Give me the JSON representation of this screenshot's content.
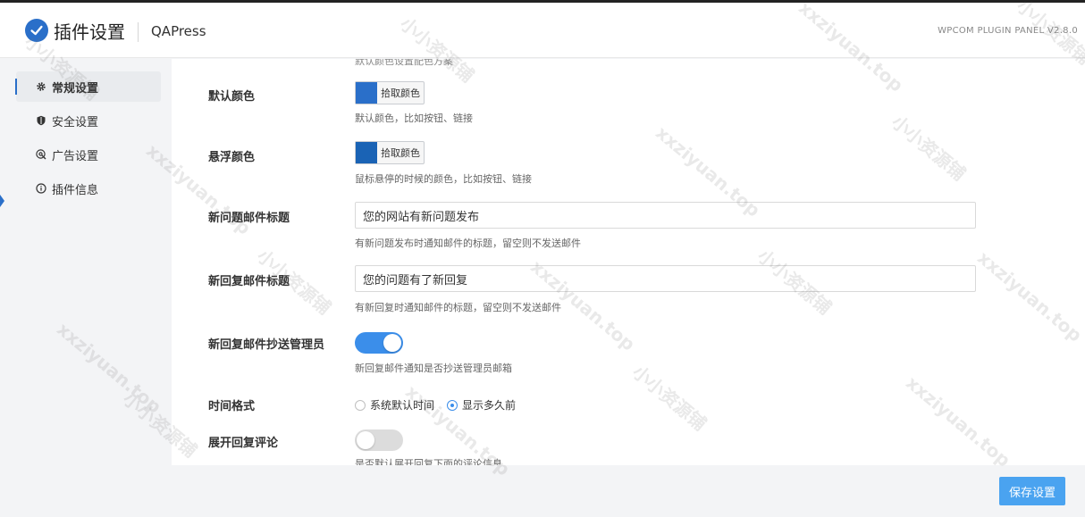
{
  "header": {
    "title": "插件设置",
    "plugin_name": "QAPress",
    "panel_version": "WPCOM PLUGIN PANEL V2.8.0",
    "logo_icon": "check-badge-icon"
  },
  "sidebar": {
    "items": [
      {
        "label": "常规设置",
        "icon": "gear-icon",
        "active": true
      },
      {
        "label": "安全设置",
        "icon": "shield-icon",
        "active": false
      },
      {
        "label": "广告设置",
        "icon": "ad-target-icon",
        "active": false
      },
      {
        "label": "插件信息",
        "icon": "info-icon",
        "active": false
      }
    ]
  },
  "main": {
    "cut_hint": "默认颜色设置配色方案",
    "default_color": {
      "label": "默认颜色",
      "button": "拾取颜色",
      "color": "#2a6fc9",
      "desc": "默认颜色，比如按钮、链接"
    },
    "hover_color": {
      "label": "悬浮颜色",
      "button": "拾取颜色",
      "color": "#1a63b5",
      "desc": "鼠标悬停的时候的颜色，比如按钮、链接"
    },
    "new_question_subject": {
      "label": "新问题邮件标题",
      "value": "您的网站有新问题发布",
      "desc": "有新问题发布时通知邮件的标题，留空则不发送邮件"
    },
    "new_reply_subject": {
      "label": "新回复邮件标题",
      "value": "您的问题有了新回复",
      "desc": "有新回复时通知邮件的标题，留空则不发送邮件"
    },
    "cc_admin": {
      "label": "新回复邮件抄送管理员",
      "on": true,
      "desc": "新回复邮件通知是否抄送管理员邮箱"
    },
    "time_format": {
      "label": "时间格式",
      "options": [
        "系统默认时间",
        "显示多久前"
      ],
      "selected": "显示多久前"
    },
    "expand_replies": {
      "label": "展开回复评论",
      "on": false,
      "desc": "是否默认展开回复下面的评论信息"
    }
  },
  "footer": {
    "save_label": "保存设置"
  },
  "colors": {
    "accent": "#3b8eea",
    "save_button": "#4aa3f0"
  },
  "watermarks": [
    "xxziyuan.top",
    "小小资源铺"
  ]
}
